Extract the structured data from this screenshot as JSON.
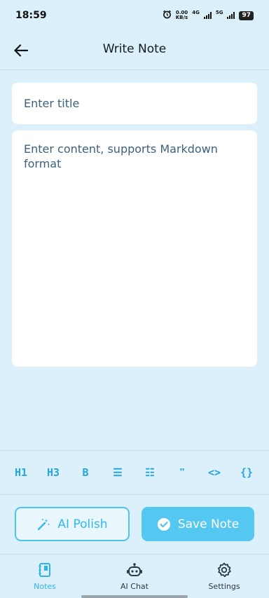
{
  "status_bar": {
    "time": "18:59",
    "net_speed_value": "0.00",
    "net_speed_unit": "KB/s",
    "net_type_a": "4G",
    "net_type_b": "5G",
    "battery": "97"
  },
  "app_bar": {
    "title": "Write Note",
    "back_icon": "arrow-left-icon"
  },
  "editor": {
    "title_placeholder": "Enter title",
    "title_value": "",
    "content_placeholder": "Enter content, supports Markdown format",
    "content_value": ""
  },
  "toolbar": {
    "items": [
      {
        "label": "H1",
        "name": "h1"
      },
      {
        "label": "H3",
        "name": "h3"
      },
      {
        "label": "B",
        "name": "bold"
      },
      {
        "label": "☰",
        "name": "bullet-list"
      },
      {
        "label": "☷",
        "name": "numbered-list"
      },
      {
        "label": "❞",
        "name": "quote"
      },
      {
        "label": "<>",
        "name": "inline-code"
      },
      {
        "label": "{}",
        "name": "code-block"
      },
      {
        "label": "<",
        "name": "more"
      }
    ]
  },
  "actions": {
    "ai_polish_label": "AI Polish",
    "save_note_label": "Save Note"
  },
  "bottom_nav": {
    "items": [
      {
        "label": "Notes",
        "icon": "notebook-icon",
        "active": true
      },
      {
        "label": "AI Chat",
        "icon": "robot-icon",
        "active": false
      },
      {
        "label": "Settings",
        "icon": "gear-icon",
        "active": false
      }
    ]
  },
  "colors": {
    "accent": "#55c8f1",
    "background": "#dcf0fb"
  }
}
